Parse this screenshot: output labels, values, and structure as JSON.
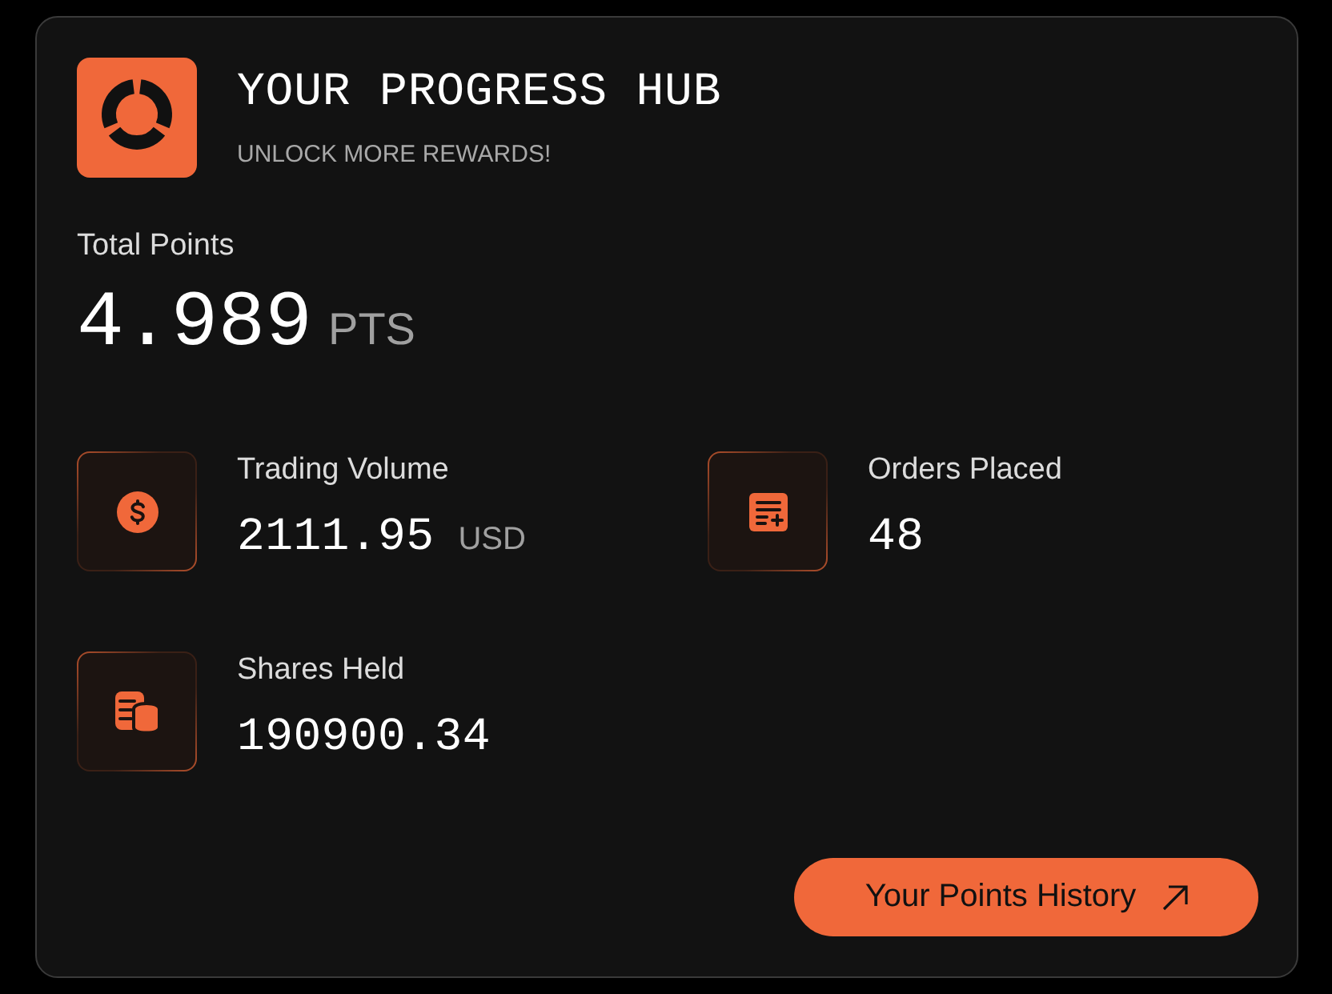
{
  "header": {
    "title": "YOUR PROGRESS HUB",
    "subtitle": "UNLOCK MORE REWARDS!"
  },
  "total": {
    "label": "Total Points",
    "value": "4.989",
    "unit": "PTS"
  },
  "stats": [
    {
      "kind": "dollar",
      "label": "Trading Volume",
      "value": "2111.95",
      "unit": "USD"
    },
    {
      "kind": "orders",
      "label": "Orders Placed",
      "value": "48"
    },
    {
      "kind": "shares",
      "label": "Shares Held",
      "value": "190900.34"
    }
  ],
  "button": {
    "label": "Your Points History"
  }
}
